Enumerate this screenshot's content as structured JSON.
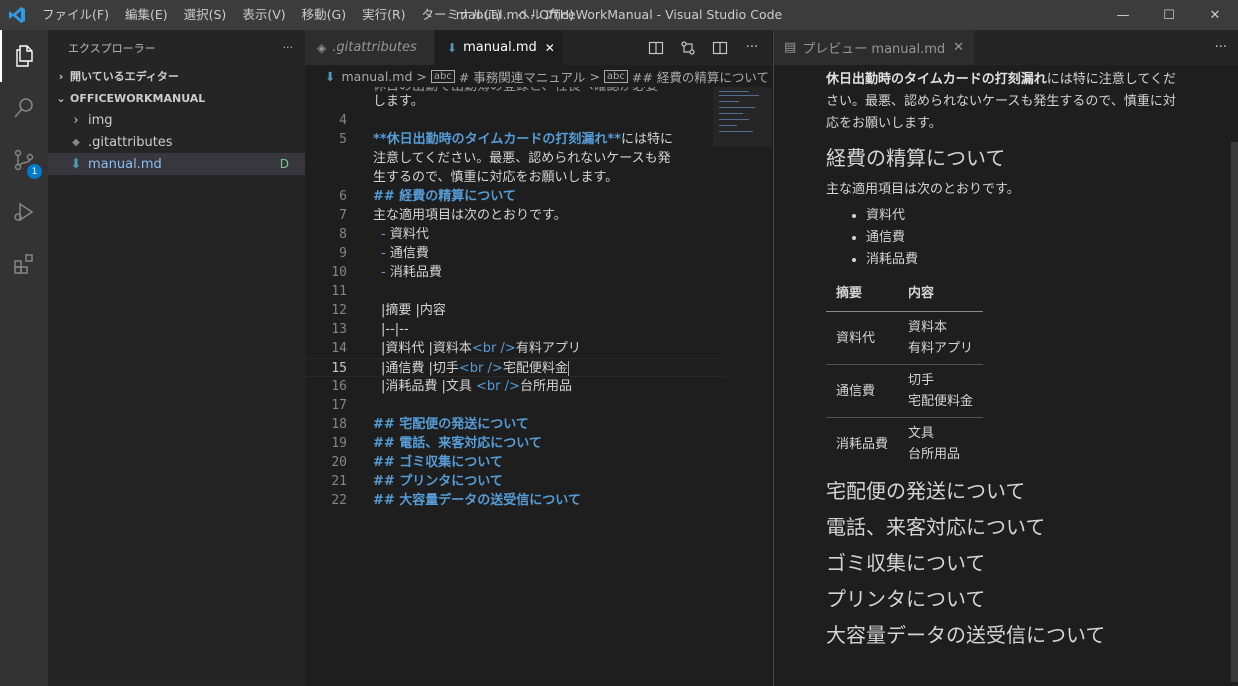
{
  "titlebar": {
    "title": "manual.md - OfficeWorkManual - Visual Studio Code",
    "menu": [
      "ファイル(F)",
      "編集(E)",
      "選択(S)",
      "表示(V)",
      "移動(G)",
      "実行(R)",
      "ターミナル(T)",
      "ヘルプ(H)"
    ],
    "minimize": "—",
    "maximize": "☐",
    "close": "✕"
  },
  "activitybar": {
    "icons": [
      "explorer-icon",
      "search-icon",
      "source-control-icon",
      "run-debug-icon",
      "extensions-icon"
    ],
    "scm_badge": "1"
  },
  "sidebar": {
    "header": "エクスプローラー",
    "more": "···",
    "open_editors": "開いているエディター",
    "project": "OFFICEWORKMANUAL",
    "items": [
      {
        "label": "img",
        "icon": "chevron-right-icon"
      },
      {
        "label": ".gitattributes",
        "icon": "git-file-icon"
      },
      {
        "label": "manual.md",
        "icon": "markdown-file-icon",
        "decoration": "D"
      }
    ]
  },
  "editor": {
    "tabs": [
      {
        "label": ".gitattributes",
        "icon": "◈"
      },
      {
        "label": "manual.md",
        "icon": "⬇",
        "close": "✕"
      }
    ],
    "actions": [
      "open-preview-icon",
      "compare-changes-icon",
      "split-editor-icon",
      "more-actions-icon"
    ],
    "breadcrumb": {
      "file": "manual.md",
      "h1": "# 事務関連マニュアル",
      "h2": "## 経費の精算について",
      "sep": ">"
    },
    "partial_top_line": "休日の出勤で出勤簿の登録と、社長へ確認が必要",
    "partial_top_line2": "します。",
    "lines": {
      "n4": "4",
      "n5": "5",
      "l5a_bold": "**休日出勤時のタイムカードの打刻漏れ**",
      "l5a_rest": "には特に",
      "l5b": "注意してください。最悪、認められないケースも発",
      "l5c": "生するので、慎重に対応をお願いします。",
      "n6": "6",
      "l6": "## 経費の精算について",
      "n7": "7",
      "l7": "主な適用項目は次のとおりです。",
      "n8": "8",
      "l8_dash": "-",
      "l8": "資料代",
      "n9": "9",
      "l9_dash": "-",
      "l9": "通信費",
      "n10": "10",
      "l10_dash": "-",
      "l10": "消耗品費",
      "n11": "11",
      "n12": "12",
      "l12": "|摘要 |内容",
      "n13": "13",
      "l13": "|--|--",
      "n14": "14",
      "l14a": "|資料代 |資料本",
      "l14b": "<br />",
      "l14c": "有料アプリ",
      "n15": "15",
      "l15a": "|通信費 |切手",
      "l15b": "<br />",
      "l15c": "宅配便料金",
      "n16": "16",
      "l16a": "|消耗品費 |文具 ",
      "l16b": "<br />",
      "l16c": "台所用品",
      "n17": "17",
      "n18": "18",
      "l18": "## 宅配便の発送について",
      "n19": "19",
      "l19": "## 電話、来客対応について",
      "n20": "20",
      "l20": "## ゴミ収集について",
      "n21": "21",
      "l21": "## プリンタについて",
      "n22": "22",
      "l22": "## 大容量データの送受信について"
    }
  },
  "preview": {
    "tab_label": "プレビュー manual.md",
    "close": "✕",
    "more": "···",
    "intro_bold": "休日出勤時のタイムカードの打刻漏れ",
    "intro_rest": "には特に注意してください。最悪、認められないケースも発生するので、慎重に対応をお願いします。",
    "h_expense": "経費の精算について",
    "p_items": "主な適用項目は次のとおりです。",
    "list": [
      "資料代",
      "通信費",
      "消耗品費"
    ],
    "table": {
      "headers": [
        "摘要",
        "内容"
      ],
      "rows": [
        {
          "k": "資料代",
          "v1": "資料本",
          "v2": "有料アプリ"
        },
        {
          "k": "通信費",
          "v1": "切手",
          "v2": "宅配便料金"
        },
        {
          "k": "消耗品費",
          "v1": "文具",
          "v2": "台所用品"
        }
      ]
    },
    "h_delivery": "宅配便の発送について",
    "h_phone": "電話、来客対応について",
    "h_garbage": "ゴミ収集について",
    "h_printer": "プリンタについて",
    "h_data": "大容量データの送受信について"
  },
  "colors": {
    "accent": "#007acc",
    "heading": "#569cd6",
    "modified": "#73c991"
  }
}
